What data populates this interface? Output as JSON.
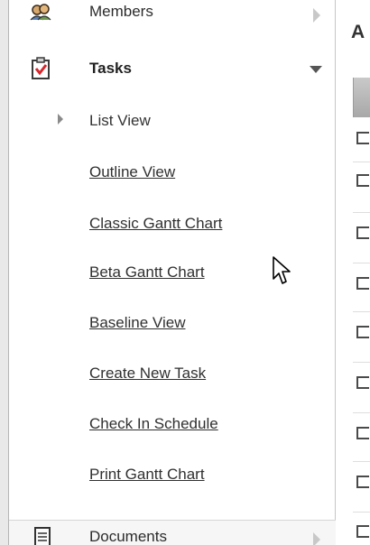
{
  "sidebar": {
    "members": {
      "label": "Members",
      "icon": "members-icon"
    },
    "tasks": {
      "label": "Tasks",
      "icon": "clipboard-check-icon"
    },
    "task_items": [
      {
        "label": "List View",
        "selected": true
      },
      {
        "label": "Outline View"
      },
      {
        "label": "Classic Gantt Chart"
      },
      {
        "label": "Beta Gantt Chart"
      },
      {
        "label": "Baseline View"
      },
      {
        "label": "Create New Task"
      },
      {
        "label": "Check In Schedule"
      },
      {
        "label": "Print Gantt Chart"
      }
    ],
    "documents": {
      "label": "Documents",
      "icon": "document-icon"
    }
  },
  "main": {
    "heading_fragment": "A"
  },
  "colors": {
    "accent_red": "#d7262b",
    "text": "#303030",
    "header_gray": "#b5b5b5"
  }
}
